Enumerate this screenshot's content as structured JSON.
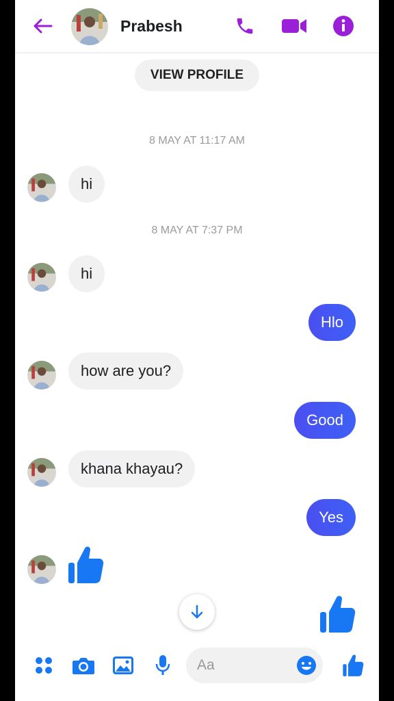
{
  "header": {
    "contact_name": "Prabesh",
    "icons": [
      "back-arrow-icon",
      "phone-icon",
      "video-camera-icon",
      "info-icon"
    ]
  },
  "view_profile_label": "VIEW PROFILE",
  "timestamps": [
    "8 MAY AT 11:17 AM",
    "8 MAY AT 7:37 PM"
  ],
  "messages": [
    {
      "sender": "contact",
      "text": "hi"
    },
    {
      "sender": "contact",
      "text": "hi"
    },
    {
      "sender": "me",
      "text": "Hlo"
    },
    {
      "sender": "contact",
      "text": "how are you?"
    },
    {
      "sender": "me",
      "text": "Good"
    },
    {
      "sender": "contact",
      "text": "khana khayau?"
    },
    {
      "sender": "me",
      "text": "Yes"
    },
    {
      "sender": "contact",
      "text": "thumbs-up-like"
    },
    {
      "sender": "me",
      "text": "thumbs-up-like"
    }
  ],
  "composer": {
    "placeholder": "Aa",
    "icons": [
      "menu-dots-icon",
      "camera-icon",
      "gallery-icon",
      "microphone-icon",
      "emoji-icon",
      "thumbs-up-icon"
    ]
  },
  "colors": {
    "header_accent": "#9b1ed8",
    "outgoing_bubble": "#4556f2",
    "incoming_bubble": "#f1f1f1",
    "composer_accent": "#1877f2"
  }
}
